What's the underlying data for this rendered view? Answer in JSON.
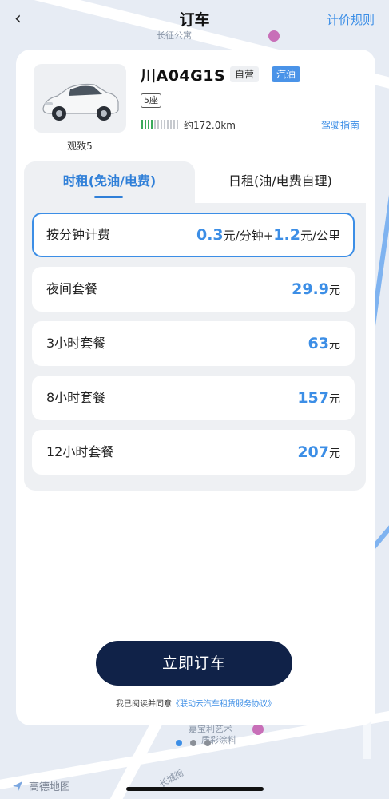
{
  "header": {
    "title": "订车",
    "back_icon": "‹",
    "rules_label": "计价规则"
  },
  "map": {
    "labels": [
      "长征公寓",
      "嘉宝利艺术",
      "质彩涂料",
      "长城街"
    ],
    "provider": "高德地图"
  },
  "vehicle": {
    "plate": "川A04G1S",
    "owner_tag": "自营",
    "fuel_tag": "汽油",
    "seats": "5座",
    "model": "观致5",
    "range_text": "约172.0km",
    "range_level": 0.35,
    "guide_label": "驾驶指南",
    "colors": {
      "fuel_tag": "#4a93e8",
      "range_on": "#3aaa5a"
    }
  },
  "tabs": {
    "hourly": "时租(免油/电费)",
    "daily": "日租(油/电费自理)",
    "active": "hourly"
  },
  "plans": [
    {
      "label": "按分钟计费",
      "selected": true,
      "price_parts": [
        "0.3",
        "元/分钟+",
        "1.2",
        "元/公里"
      ]
    },
    {
      "label": "夜间套餐",
      "price": "29.9",
      "unit": "元"
    },
    {
      "label": "3小时套餐",
      "price": "63",
      "unit": "元"
    },
    {
      "label": "8小时套餐",
      "price": "157",
      "unit": "元"
    },
    {
      "label": "12小时套餐",
      "price": "207",
      "unit": "元"
    }
  ],
  "order": {
    "button_label": "立即订车",
    "agreement_prefix": "我已阅读并同意",
    "agreement_link": "《联动云汽车租赁服务协议》"
  },
  "pager": {
    "current": 1,
    "total": 3
  },
  "colors": {
    "accent": "#3c8ee6",
    "button": "#102248"
  }
}
